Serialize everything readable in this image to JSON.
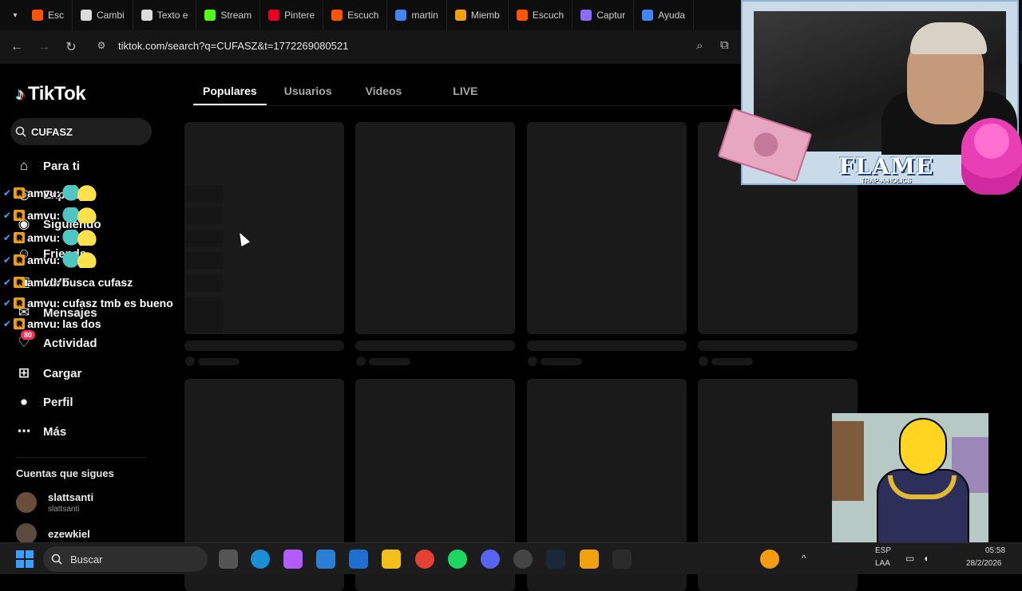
{
  "browser": {
    "tabs": [
      {
        "label": "Esc",
        "color": "#ff5500"
      },
      {
        "label": "Cambi",
        "color": "#dcdcdc"
      },
      {
        "label": "Texto e",
        "color": "#dcdcdc"
      },
      {
        "label": "Stream",
        "color": "#53fc18"
      },
      {
        "label": "Pintere",
        "color": "#e60023"
      },
      {
        "label": "Escuch",
        "color": "#ff5500"
      },
      {
        "label": "martin",
        "color": "#4285f4"
      },
      {
        "label": "Miemb",
        "color": "#f1a10e"
      },
      {
        "label": "Escuch",
        "color": "#ff5500"
      },
      {
        "label": "Captur",
        "color": "#8a6cff"
      },
      {
        "label": "Ayuda",
        "color": "#4285f4"
      }
    ],
    "url": "tiktok.com/search?q=CUFASZ&t=1772269080521"
  },
  "tiktok": {
    "logo_text": "TikTok",
    "search_value": "CUFASZ",
    "nav": [
      {
        "label": "Para ti",
        "icon": "home-icon"
      },
      {
        "label": "Explorar",
        "icon": "compass-icon"
      },
      {
        "label": "Siguiendo",
        "icon": "following-icon"
      },
      {
        "label": "Friends",
        "icon": "friends-icon"
      },
      {
        "label": "LIVE",
        "icon": "live-icon"
      },
      {
        "label": "Mensajes",
        "icon": "messages-icon"
      },
      {
        "label": "Actividad",
        "icon": "activity-icon",
        "badge": "80"
      },
      {
        "label": "Cargar",
        "icon": "upload-icon"
      },
      {
        "label": "Perfil",
        "icon": "profile-icon"
      },
      {
        "label": "Más",
        "icon": "more-icon"
      }
    ],
    "following_title": "Cuentas que sigues",
    "accounts": [
      {
        "name": "slattsanti",
        "handle": "slattsanti"
      },
      {
        "name": "ezewkiel",
        "handle": ""
      }
    ],
    "tabs": [
      "Populares",
      "Usuarios",
      "Videos",
      "LIVE"
    ],
    "active_tab": "Populares"
  },
  "chat": [
    {
      "user": "amvu:",
      "text": ""
    },
    {
      "user": "amvu:",
      "text": ""
    },
    {
      "user": "amvu:",
      "text": ""
    },
    {
      "user": "amvu:",
      "text": ""
    },
    {
      "user": "amvu:",
      "text": "busca cufasz"
    },
    {
      "user": "amvu:",
      "text": "cufasz tmb es bueno"
    },
    {
      "user": "amvu:",
      "text": "las dos"
    }
  ],
  "overlay": {
    "title": "FLAME",
    "subtitle": "TRAP-A-HOLICS"
  },
  "taskbar": {
    "search_placeholder": "Buscar",
    "lang": "ESP",
    "region": "LAA",
    "time": "05:58",
    "date": "28/2/2026"
  }
}
